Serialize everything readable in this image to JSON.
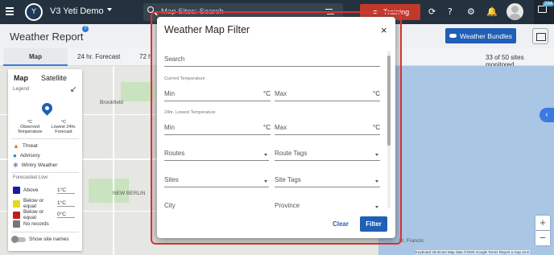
{
  "topbar": {
    "app_name": "V3 Yeti Demo",
    "search_placeholder": "Map Sites: Search",
    "training_label": "Training",
    "notification_count": "294",
    "logo_text": "Y"
  },
  "header": {
    "title": "Weather Report",
    "help_glyph": "?",
    "bundles_label": "Weather Bundles"
  },
  "tabs": [
    {
      "label": "Map"
    },
    {
      "label": "24 hr. Forecast"
    },
    {
      "label": "72 h"
    }
  ],
  "status": {
    "monitored": "33 of 50 sites monitored"
  },
  "map_labels": {
    "brookfield": "Brookfield",
    "new_berlin": "NEW BERLIN",
    "st_francis": "St. Francis",
    "ghost": "Map"
  },
  "legend": {
    "map_tab": "Map",
    "satellite_tab": "Satellite",
    "title": "Legend",
    "pin_left_top": "°C",
    "pin_left_bottom": "Observed Temperature",
    "pin_right_top": "°C",
    "pin_right_bottom": "Lowest 24hr. Forecast",
    "threat": "Threat",
    "advisory": "Advisory",
    "wintry": "Wintry Weather",
    "forecasted_low": "Forecasted Low:",
    "rows": [
      {
        "label": "Above",
        "value": "1°C",
        "color": "#1a1aa8"
      },
      {
        "label": "Below or equal",
        "value": "1°C",
        "color": "#e3d81a"
      },
      {
        "label": "Below or equal",
        "value": "0°C",
        "color": "#c31c1c"
      },
      {
        "label": "No records",
        "value": "",
        "color": "#777777"
      }
    ],
    "show_names": "Show site names"
  },
  "modal": {
    "title": "Weather Map Filter",
    "close": "×",
    "search_placeholder": "Search",
    "current_temp_label": "Current Temperature",
    "lowest_temp_label": "24hr. Lowest Temperature",
    "min": "Min",
    "max": "Max",
    "unit": "°C",
    "routes": "Routes",
    "route_tags": "Route Tags",
    "sites": "Sites",
    "site_tags": "Site Tags",
    "city": "City",
    "province": "Province",
    "clear": "Clear",
    "filter": "Filter"
  },
  "zoom": {
    "in": "+",
    "out": "−"
  },
  "attribution": "Keyboard shortcuts   Map data ©2025 Google   Terms   Report a map error"
}
